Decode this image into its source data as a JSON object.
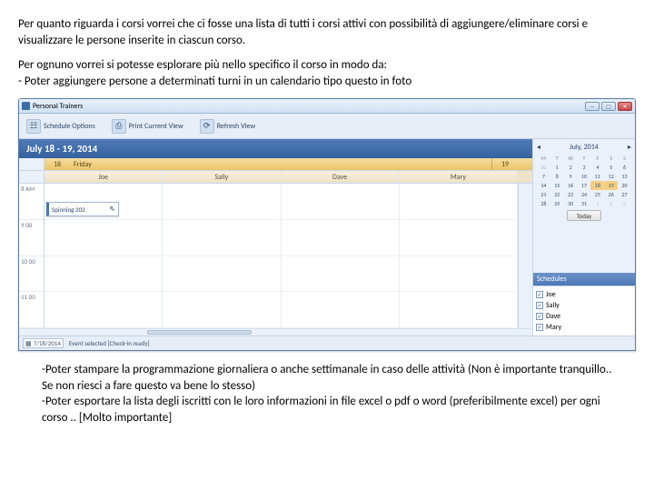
{
  "text": {
    "p1": "Per quanto riguarda i corsi vorrei che ci fosse una lista di tutti i corsi  attivi con possibilità di aggiungere/eliminare corsi e visualizzare le persone inserite in ciascun corso.",
    "p2": "Per ognuno vorrei si potesse esplorare più nello specifico il corso in modo da:\n- Poter aggiungere persone a determinati turni in un calendario tipo questo in foto",
    "p3": "-Poter stampare la programmazione giornaliera o anche settimanale in caso delle attività (Non è importante tranquillo.. Se non riesci a fare questo va bene lo stesso)\n-Poter esportare la lista degli iscritti con le loro informazioni in file excel o pdf o word (preferibilmente excel) per ogni corso .. [Molto importante]"
  },
  "app": {
    "title": "Personal Trainers",
    "toolbar": {
      "schedule_options": "Schedule Options",
      "print": "Print Current View",
      "refresh": "Refresh View"
    },
    "date_range": "July 18 - 19, 2014",
    "dayhead": {
      "num18": "18",
      "dayname": "Friday",
      "num19": "19"
    },
    "trainers": [
      "Joe",
      "Sally",
      "Dave",
      "Mary"
    ],
    "times": [
      "8 AM",
      "9 00",
      "10 00",
      "11 00"
    ],
    "event": {
      "title": "Spinning 202"
    },
    "month": {
      "title": "July, 2014",
      "dow": [
        "M",
        "T",
        "W",
        "T",
        "F",
        "S",
        "S"
      ],
      "pre": [
        "30"
      ],
      "days": [
        "1",
        "2",
        "3",
        "4",
        "5",
        "6",
        "7",
        "8",
        "9",
        "10",
        "11",
        "12",
        "13",
        "14",
        "15",
        "16",
        "17",
        "18",
        "19",
        "20",
        "21",
        "22",
        "23",
        "24",
        "25",
        "26",
        "27",
        "28",
        "29",
        "30",
        "31"
      ],
      "post": [
        "1",
        "2",
        "3"
      ],
      "today": "Today"
    },
    "schedules": {
      "header": "Schedules"
    },
    "status": {
      "date": "7/18/2014",
      "msg": "Event selected  [Check-in ready]"
    }
  }
}
